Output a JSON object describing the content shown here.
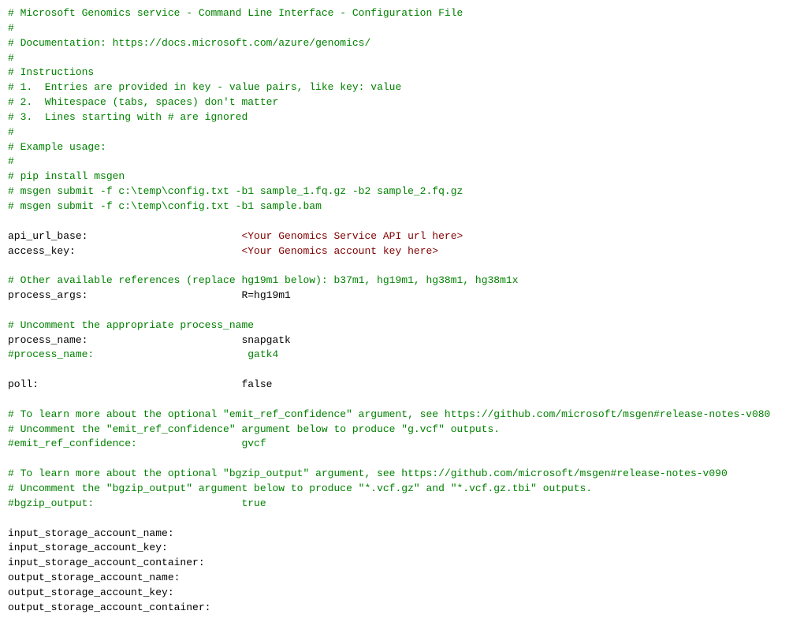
{
  "content": {
    "lines": [
      {
        "text": "# Microsoft Genomics service - Command Line Interface - Configuration File",
        "type": "comment"
      },
      {
        "text": "#",
        "type": "comment"
      },
      {
        "text": "# Documentation: https://docs.microsoft.com/azure/genomics/",
        "type": "comment"
      },
      {
        "text": "#",
        "type": "comment"
      },
      {
        "text": "# Instructions",
        "type": "comment"
      },
      {
        "text": "# 1.  Entries are provided in key - value pairs, like key: value",
        "type": "comment"
      },
      {
        "text": "# 2.  Whitespace (tabs, spaces) don't matter",
        "type": "comment"
      },
      {
        "text": "# 3.  Lines starting with # are ignored",
        "type": "comment"
      },
      {
        "text": "#",
        "type": "comment"
      },
      {
        "text": "# Example usage:",
        "type": "comment"
      },
      {
        "text": "#",
        "type": "comment"
      },
      {
        "text": "# pip install msgen",
        "type": "comment"
      },
      {
        "text": "# msgen submit -f c:\\temp\\config.txt -b1 sample_1.fq.gz -b2 sample_2.fq.gz",
        "type": "comment"
      },
      {
        "text": "# msgen submit -f c:\\temp\\config.txt -b1 sample.bam",
        "type": "comment"
      },
      {
        "text": "",
        "type": "blank"
      },
      {
        "text": "api_url_base:                         <Your Genomics Service API url here>",
        "type": "mixed",
        "key": "api_url_base:",
        "spacing": "                         ",
        "placeholder": "<Your Genomics Service API url here>"
      },
      {
        "text": "access_key:                           <Your Genomics account key here>",
        "type": "mixed",
        "key": "access_key:",
        "spacing": "                           ",
        "placeholder": "<Your Genomics account key here>"
      },
      {
        "text": "",
        "type": "blank"
      },
      {
        "text": "# Other available references (replace hg19m1 below): b37m1, hg19m1, hg38m1, hg38m1x",
        "type": "comment"
      },
      {
        "text": "process_args:                         R=hg19m1",
        "type": "keyval"
      },
      {
        "text": "",
        "type": "blank"
      },
      {
        "text": "# Uncomment the appropriate process_name",
        "type": "comment"
      },
      {
        "text": "process_name:                         snapgatk",
        "type": "keyval"
      },
      {
        "text": "#process_name:                         gatk4",
        "type": "comment"
      },
      {
        "text": "",
        "type": "blank"
      },
      {
        "text": "poll:                                 false",
        "type": "keyval"
      },
      {
        "text": "",
        "type": "blank"
      },
      {
        "text": "# To learn more about the optional \"emit_ref_confidence\" argument, see https://github.com/microsoft/msgen#release-notes-v080",
        "type": "comment"
      },
      {
        "text": "# Uncomment the \"emit_ref_confidence\" argument below to produce \"g.vcf\" outputs.",
        "type": "comment"
      },
      {
        "text": "#emit_ref_confidence:                 gvcf",
        "type": "comment"
      },
      {
        "text": "",
        "type": "blank"
      },
      {
        "text": "# To learn more about the optional \"bgzip_output\" argument, see https://github.com/microsoft/msgen#release-notes-v090",
        "type": "comment"
      },
      {
        "text": "# Uncomment the \"bgzip_output\" argument below to produce \"*.vcf.gz\" and \"*.vcf.gz.tbi\" outputs.",
        "type": "comment"
      },
      {
        "text": "#bgzip_output:                        true",
        "type": "comment"
      },
      {
        "text": "",
        "type": "blank"
      },
      {
        "text": "input_storage_account_name:",
        "type": "keyval"
      },
      {
        "text": "input_storage_account_key:",
        "type": "keyval"
      },
      {
        "text": "input_storage_account_container:",
        "type": "keyval"
      },
      {
        "text": "output_storage_account_name:",
        "type": "keyval"
      },
      {
        "text": "output_storage_account_key:",
        "type": "keyval"
      },
      {
        "text": "output_storage_account_container:",
        "type": "keyval"
      }
    ]
  }
}
